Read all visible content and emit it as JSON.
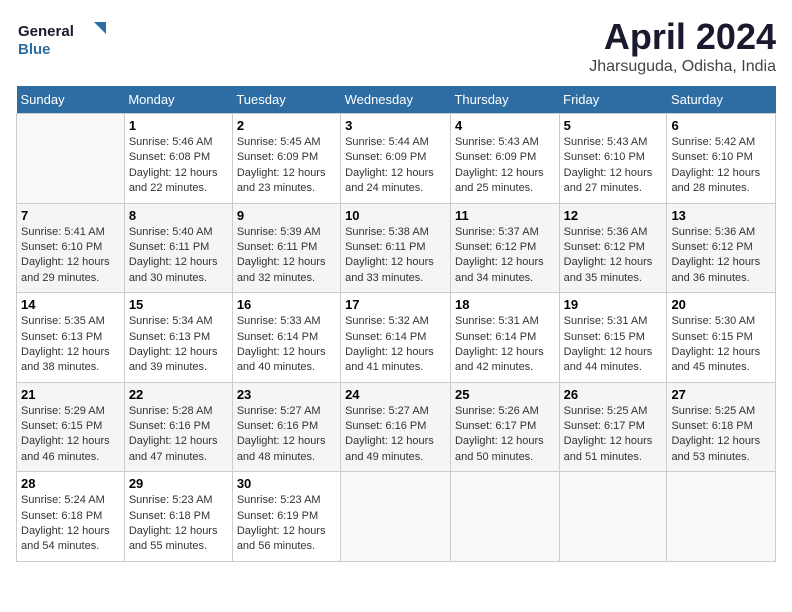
{
  "header": {
    "logo_line1": "General",
    "logo_line2": "Blue",
    "month_title": "April 2024",
    "subtitle": "Jharsuguda, Odisha, India"
  },
  "days_of_week": [
    "Sunday",
    "Monday",
    "Tuesday",
    "Wednesday",
    "Thursday",
    "Friday",
    "Saturday"
  ],
  "weeks": [
    [
      {
        "day": "",
        "info": ""
      },
      {
        "day": "1",
        "info": "Sunrise: 5:46 AM\nSunset: 6:08 PM\nDaylight: 12 hours\nand 22 minutes."
      },
      {
        "day": "2",
        "info": "Sunrise: 5:45 AM\nSunset: 6:09 PM\nDaylight: 12 hours\nand 23 minutes."
      },
      {
        "day": "3",
        "info": "Sunrise: 5:44 AM\nSunset: 6:09 PM\nDaylight: 12 hours\nand 24 minutes."
      },
      {
        "day": "4",
        "info": "Sunrise: 5:43 AM\nSunset: 6:09 PM\nDaylight: 12 hours\nand 25 minutes."
      },
      {
        "day": "5",
        "info": "Sunrise: 5:43 AM\nSunset: 6:10 PM\nDaylight: 12 hours\nand 27 minutes."
      },
      {
        "day": "6",
        "info": "Sunrise: 5:42 AM\nSunset: 6:10 PM\nDaylight: 12 hours\nand 28 minutes."
      }
    ],
    [
      {
        "day": "7",
        "info": "Sunrise: 5:41 AM\nSunset: 6:10 PM\nDaylight: 12 hours\nand 29 minutes."
      },
      {
        "day": "8",
        "info": "Sunrise: 5:40 AM\nSunset: 6:11 PM\nDaylight: 12 hours\nand 30 minutes."
      },
      {
        "day": "9",
        "info": "Sunrise: 5:39 AM\nSunset: 6:11 PM\nDaylight: 12 hours\nand 32 minutes."
      },
      {
        "day": "10",
        "info": "Sunrise: 5:38 AM\nSunset: 6:11 PM\nDaylight: 12 hours\nand 33 minutes."
      },
      {
        "day": "11",
        "info": "Sunrise: 5:37 AM\nSunset: 6:12 PM\nDaylight: 12 hours\nand 34 minutes."
      },
      {
        "day": "12",
        "info": "Sunrise: 5:36 AM\nSunset: 6:12 PM\nDaylight: 12 hours\nand 35 minutes."
      },
      {
        "day": "13",
        "info": "Sunrise: 5:36 AM\nSunset: 6:12 PM\nDaylight: 12 hours\nand 36 minutes."
      }
    ],
    [
      {
        "day": "14",
        "info": "Sunrise: 5:35 AM\nSunset: 6:13 PM\nDaylight: 12 hours\nand 38 minutes."
      },
      {
        "day": "15",
        "info": "Sunrise: 5:34 AM\nSunset: 6:13 PM\nDaylight: 12 hours\nand 39 minutes."
      },
      {
        "day": "16",
        "info": "Sunrise: 5:33 AM\nSunset: 6:14 PM\nDaylight: 12 hours\nand 40 minutes."
      },
      {
        "day": "17",
        "info": "Sunrise: 5:32 AM\nSunset: 6:14 PM\nDaylight: 12 hours\nand 41 minutes."
      },
      {
        "day": "18",
        "info": "Sunrise: 5:31 AM\nSunset: 6:14 PM\nDaylight: 12 hours\nand 42 minutes."
      },
      {
        "day": "19",
        "info": "Sunrise: 5:31 AM\nSunset: 6:15 PM\nDaylight: 12 hours\nand 44 minutes."
      },
      {
        "day": "20",
        "info": "Sunrise: 5:30 AM\nSunset: 6:15 PM\nDaylight: 12 hours\nand 45 minutes."
      }
    ],
    [
      {
        "day": "21",
        "info": "Sunrise: 5:29 AM\nSunset: 6:15 PM\nDaylight: 12 hours\nand 46 minutes."
      },
      {
        "day": "22",
        "info": "Sunrise: 5:28 AM\nSunset: 6:16 PM\nDaylight: 12 hours\nand 47 minutes."
      },
      {
        "day": "23",
        "info": "Sunrise: 5:27 AM\nSunset: 6:16 PM\nDaylight: 12 hours\nand 48 minutes."
      },
      {
        "day": "24",
        "info": "Sunrise: 5:27 AM\nSunset: 6:16 PM\nDaylight: 12 hours\nand 49 minutes."
      },
      {
        "day": "25",
        "info": "Sunrise: 5:26 AM\nSunset: 6:17 PM\nDaylight: 12 hours\nand 50 minutes."
      },
      {
        "day": "26",
        "info": "Sunrise: 5:25 AM\nSunset: 6:17 PM\nDaylight: 12 hours\nand 51 minutes."
      },
      {
        "day": "27",
        "info": "Sunrise: 5:25 AM\nSunset: 6:18 PM\nDaylight: 12 hours\nand 53 minutes."
      }
    ],
    [
      {
        "day": "28",
        "info": "Sunrise: 5:24 AM\nSunset: 6:18 PM\nDaylight: 12 hours\nand 54 minutes."
      },
      {
        "day": "29",
        "info": "Sunrise: 5:23 AM\nSunset: 6:18 PM\nDaylight: 12 hours\nand 55 minutes."
      },
      {
        "day": "30",
        "info": "Sunrise: 5:23 AM\nSunset: 6:19 PM\nDaylight: 12 hours\nand 56 minutes."
      },
      {
        "day": "",
        "info": ""
      },
      {
        "day": "",
        "info": ""
      },
      {
        "day": "",
        "info": ""
      },
      {
        "day": "",
        "info": ""
      }
    ]
  ]
}
